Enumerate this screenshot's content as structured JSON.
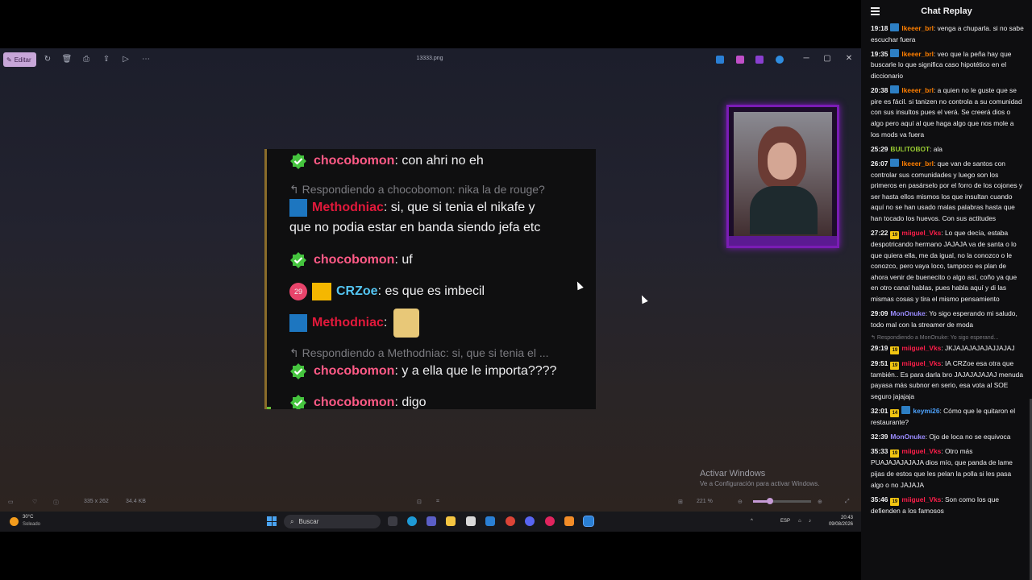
{
  "viewer": {
    "edit_label": "Editar",
    "file_name": "13333.png",
    "status": {
      "dimensions": "335 x 262",
      "file_size": "34.4 KB",
      "zoom": "221 %",
      "zoom_fraction": 0.29
    },
    "activate_title": "Activar Windows",
    "activate_sub": "Ve a Configuración para activar Windows."
  },
  "chat_image": {
    "messages": [
      {
        "user": "chocobomon",
        "text": ": con ahri no eh"
      },
      {
        "reply": "Respondiendo a chocobomon: nika la de rouge?"
      },
      {
        "user": "Methodniac",
        "text": ": si, que si tenia el nikafe y",
        "text2": "que no podia estar en banda siendo jefa etc"
      },
      {
        "user": "chocobomon",
        "text": ": uf"
      },
      {
        "badge": "29",
        "user": "CRZoe",
        "text": ": es que es imbecil"
      },
      {
        "user": "Methodniac",
        "text": ":"
      },
      {
        "reply": "Respondiendo a Methodniac: si, que si tenia el ..."
      },
      {
        "user": "chocobomon",
        "text": ": y a ella que le importa????"
      },
      {
        "user": "chocobomon",
        "text": ": digo"
      }
    ]
  },
  "taskbar": {
    "temperature": "30°C",
    "condition": "Soleado",
    "search_placeholder": "Buscar",
    "lang": "ESP",
    "time": "20:43",
    "date": "09/08/2026"
  },
  "panel": {
    "title": "Chat Replay",
    "messages": [
      {
        "ts": "19:18",
        "badge": "blue",
        "user": "lkeeer_brl",
        "color": "orange",
        "text": ": venga a chuparla. si no sabe escuchar fuera"
      },
      {
        "ts": "19:35",
        "badge": "blue",
        "user": "lkeeer_brl",
        "color": "orange",
        "text": ": veo que la peña hay que buscarle lo que significa caso hipotético en el diccionario"
      },
      {
        "ts": "20:38",
        "badge": "blue",
        "user": "lkeeer_brl",
        "color": "orange",
        "text": ": a quien no le guste que se pire es fácil. si tanizen no controla a su comunidad con sus insultos pues el verá. Se creerá dios o algo pero aquí al que haga algo que nos mole a los mods va fuera"
      },
      {
        "ts": "25:29",
        "badge": "",
        "user": "BULITOBOT",
        "color": "green",
        "text": ": ala"
      },
      {
        "ts": "26:07",
        "badge": "blue",
        "user": "lkeeer_brl",
        "color": "orange",
        "text": ": que van de santos con controlar sus comunidades y luego son los primeros en pasárselo por el forro de los cojones y ser hasta ellos mismos los que insultan cuando aquí no se han usado malas palabras hasta que han tocado los huevos. Con sus actitudes"
      },
      {
        "ts": "27:22",
        "badge": "yellow",
        "badge_text": "19",
        "user": "miiguel_Vks",
        "color": "red",
        "text": ": Lo que decía, estaba despotricando hermano JAJAJA va de santa o lo que quiera ella, me da igual, no la conozco o le conozco, pero vaya loco, tampoco es plan de ahora venir de buenecito o algo así, coño ya que en otro canal hablas, pues habla aquí y di las mismas cosas y tira el mismo pensamiento"
      },
      {
        "ts": "29:09",
        "badge": "",
        "user": "MonOnuke",
        "color": "purple",
        "text": ": Yo sigo esperando mi saludo, todo mal con la streamer de moda"
      },
      {
        "reply": "Respondiendo a MonOnuke: Yo sigo esperand...",
        "ts": "29:19",
        "badge": "yellow",
        "badge_text": "19",
        "user": "miiguel_Vks",
        "color": "red",
        "text": ": JKJAJAJAJAJAJJAJAJ"
      },
      {
        "ts": "29:51",
        "badge": "yellow",
        "badge_text": "19",
        "user": "miiguel_Vks",
        "color": "red",
        "text": ": IA CRZoe esa otra que también.. Es para darla bro JAJAJAJAJAJ menuda payasa más subnor en serio, esa vota al SOE seguro jajajaja"
      },
      {
        "ts": "32:01",
        "badge": "yellow",
        "badge_text": "14",
        "badge2": "blue",
        "user": "keymi26",
        "color": "blue",
        "text": ": Cómo que le quitaron el restaurante?"
      },
      {
        "ts": "32:39",
        "badge": "",
        "user": "MonOnuke",
        "color": "purple",
        "text": ": Ojo de loca no se equivoca"
      },
      {
        "ts": "35:33",
        "badge": "yellow",
        "badge_text": "19",
        "user": "miiguel_Vks",
        "color": "red",
        "text": ": Otro más PUAJAJAJAJAJA dios mío, que panda de lame pijas de estos que les pelan la polla si les pasa algo o no JAJAJA"
      },
      {
        "ts": "35:46",
        "badge": "yellow",
        "badge_text": "19",
        "user": "miiguel_Vks",
        "color": "red",
        "text": ": Son como los que defienden a los famosos"
      }
    ]
  }
}
